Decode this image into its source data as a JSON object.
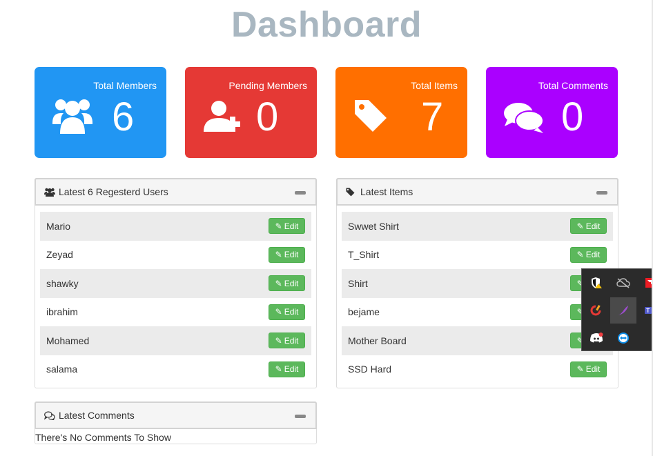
{
  "page": {
    "title": "Dashboard"
  },
  "stats": [
    {
      "label": "Total Members",
      "value": "6",
      "icon": "users-icon",
      "color": "#2196f3"
    },
    {
      "label": "Pending Members",
      "value": "0",
      "icon": "user-plus-icon",
      "color": "#e53935"
    },
    {
      "label": "Total Items",
      "value": "7",
      "icon": "tag-icon",
      "color": "#ff6f00"
    },
    {
      "label": "Total Comments",
      "value": "0",
      "icon": "comments-icon",
      "color": "#aa00ff"
    }
  ],
  "users_panel": {
    "title": "Latest 6 Regesterd Users",
    "edit_label": "Edit",
    "rows": [
      "Mario",
      "Zeyad",
      "shawky",
      "ibrahim",
      "Mohamed",
      "salama"
    ]
  },
  "items_panel": {
    "title": "Latest Items",
    "edit_label": "Edit",
    "rows": [
      "Swwet Shirt",
      "T_Shirt",
      "Shirt",
      "bejame",
      "Mother Board",
      "SSD Hard"
    ]
  },
  "comments_panel": {
    "title": "Latest Comments",
    "empty_text": "There's No Comments To Show"
  },
  "tray": {
    "icons": [
      "security-warning-icon",
      "cloud-off-icon",
      "amd-icon",
      "ccleaner-icon",
      "feather-icon",
      "teams-icon",
      "discord-icon",
      "teamviewer-icon"
    ]
  }
}
